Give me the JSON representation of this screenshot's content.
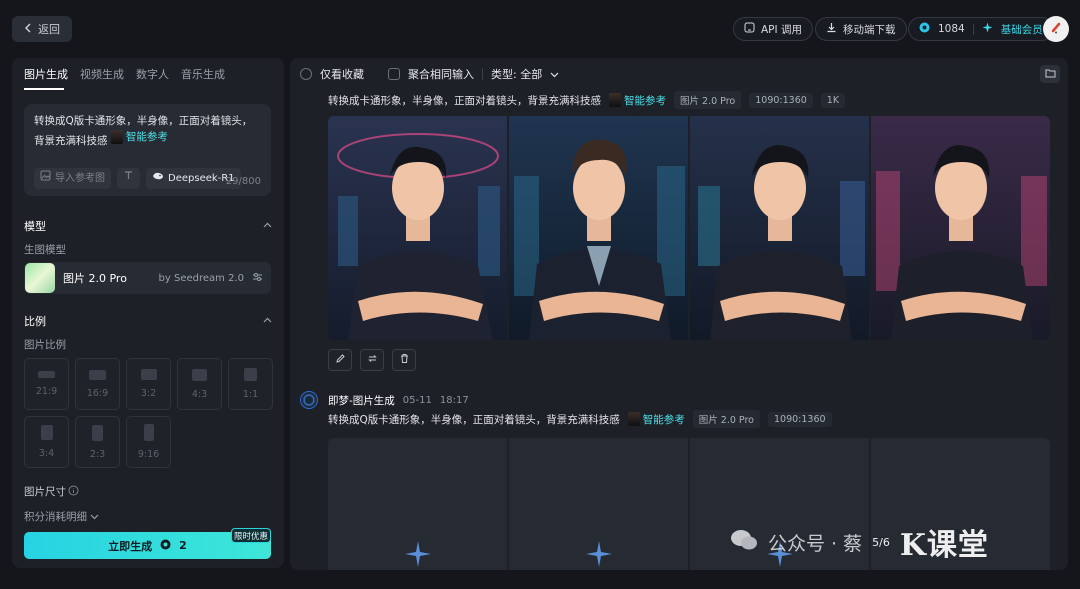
{
  "header": {
    "back_label": "返回",
    "api_label": "API 调用",
    "mobile_label": "移动端下载",
    "credits": "1084",
    "member_label": "基础会员"
  },
  "left": {
    "tabs": [
      {
        "label": "图片生成",
        "active": true
      },
      {
        "label": "视频生成",
        "active": false
      },
      {
        "label": "数字人",
        "active": false
      },
      {
        "label": "音乐生成",
        "active": false
      }
    ],
    "prompt_text": "转换成Q版卡通形象，半身像，正面对着镜头，背景充满科技感",
    "ref_label": "智能参考",
    "import_ref_label": "导入参考图",
    "deepseek_label": "Deepseek-R1",
    "char_count": "29/800",
    "model_section": "模型",
    "model_sub": "生图模型",
    "model_name": "图片 2.0 Pro",
    "model_by": "by Seedream 2.0",
    "ratio_section": "比例",
    "ratio_sub": "图片比例",
    "ratios": [
      "21:9",
      "16:9",
      "3:2",
      "4:3",
      "1:1",
      "3:4",
      "2:3",
      "9:16"
    ],
    "size_label": "图片尺寸",
    "points_label": "积分消耗明细",
    "generate_label": "立即生成",
    "generate_cost": "2",
    "promo_badge": "限时优惠"
  },
  "main": {
    "filter_favorites": "仅看收藏",
    "filter_merge": "聚合相同输入",
    "filter_type": "类型: 全部",
    "item1": {
      "prompt": "转换成卡通形象，半身像，正面对着镜头，背景充满科技感",
      "ref_label": "智能参考",
      "model": "图片 2.0 Pro",
      "size": "1090:1360",
      "res": "1K"
    },
    "item2": {
      "title": "即梦-图片生成",
      "date": "05-11",
      "time": "18:17",
      "prompt": "转换成Q版卡通形象，半身像，正面对着镜头，背景充满科技感",
      "ref_label": "智能参考",
      "model": "图片 2.0 Pro",
      "size": "1090:1360"
    }
  },
  "watermark": {
    "text": "公众号 · 蔡",
    "progress": "5/6",
    "logo": "K课堂"
  }
}
